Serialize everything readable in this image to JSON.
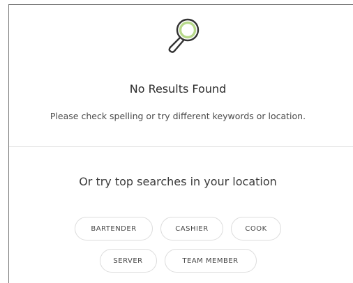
{
  "empty_state": {
    "title": "No Results Found",
    "message": "Please check spelling or try different keywords or location.",
    "icon": "search-icon",
    "accent_color": "#b7d98b"
  },
  "suggestions": {
    "heading": "Or try top searches in your location",
    "chips_row1": [
      "BARTENDER",
      "CASHIER",
      "COOK"
    ],
    "chips_row2": [
      "SERVER",
      "TEAM MEMBER"
    ]
  }
}
